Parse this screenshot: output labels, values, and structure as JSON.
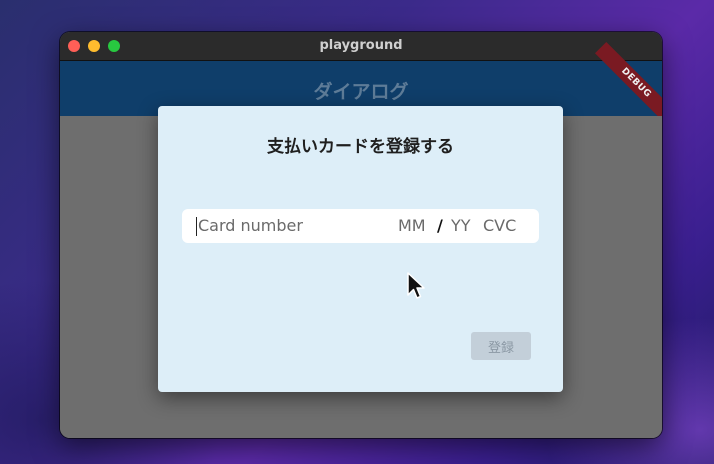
{
  "window": {
    "title": "playground"
  },
  "appbar": {
    "title": "ダイアログ",
    "debug_banner": "DEBUG"
  },
  "dialog": {
    "title": "支払いカードを登録する",
    "card_field": {
      "number_placeholder": "Card number",
      "month_placeholder": "MM",
      "separator": "/",
      "year_placeholder": "YY",
      "cvc_placeholder": "CVC"
    },
    "register_label": "登録"
  },
  "colors": {
    "appbar": "#0f3e6a",
    "dialog_bg": "#ddeef8",
    "button_disabled": "#c3cfd9",
    "debug_banner": "#7a1a22"
  }
}
